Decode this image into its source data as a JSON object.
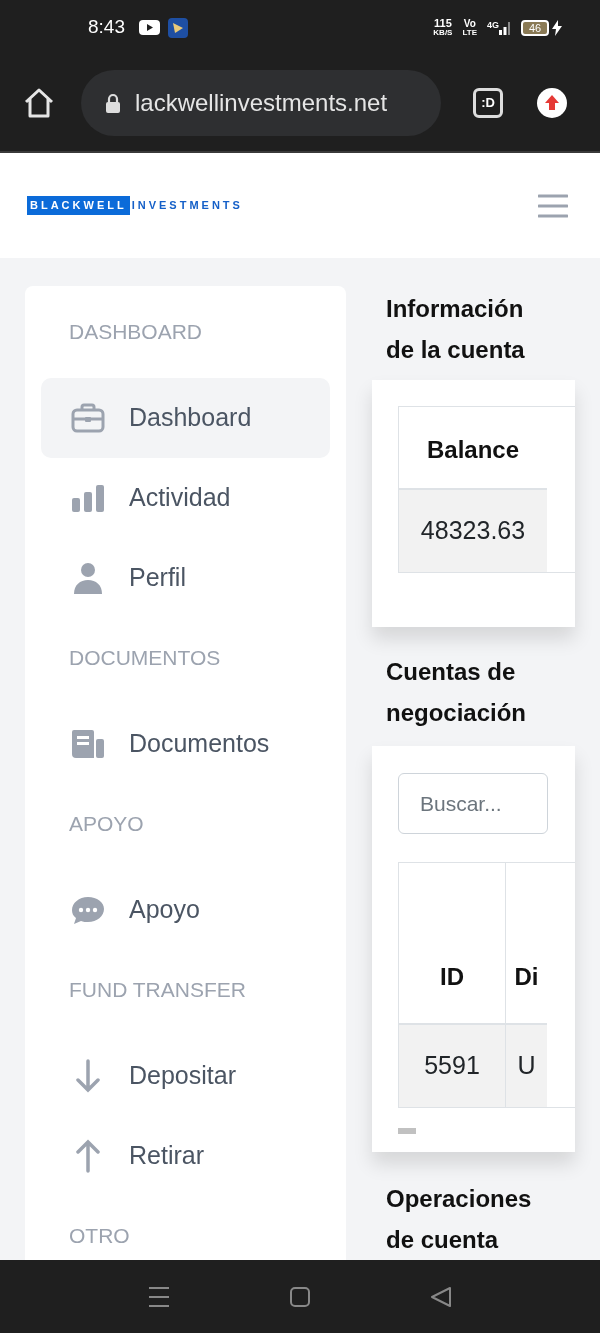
{
  "status_bar": {
    "time": "8:43",
    "speed": "115",
    "speed_unit": "KB/S",
    "volte": "Vo",
    "volte_sub": "LTE",
    "network": "4G",
    "battery": "46"
  },
  "browser": {
    "url": "lackwellinvestments.net",
    "tab_button": ":D"
  },
  "header": {
    "logo_boxed": "BLACKWELL",
    "logo_rest": "INVESTMENTS"
  },
  "sidebar": {
    "sections": [
      {
        "title": "DASHBOARD",
        "items": [
          {
            "label": "Dashboard",
            "kind": "briefcase",
            "selected": true
          },
          {
            "label": "Actividad",
            "kind": "chart",
            "selected": false
          },
          {
            "label": "Perfil",
            "kind": "user",
            "selected": false
          }
        ]
      },
      {
        "title": "DOCUMENTOS",
        "items": [
          {
            "label": "Documentos",
            "kind": "document",
            "selected": false
          }
        ]
      },
      {
        "title": "APOYO",
        "items": [
          {
            "label": "Apoyo",
            "kind": "chat",
            "selected": false
          }
        ]
      },
      {
        "title": "FUND TRANSFER",
        "items": [
          {
            "label": "Depositar",
            "kind": "down",
            "selected": false
          },
          {
            "label": "Retirar",
            "kind": "up",
            "selected": false
          }
        ]
      },
      {
        "title": "OTRO"
      }
    ]
  },
  "account_info": {
    "title": "Información de la cuenta",
    "table": {
      "columns": [
        "Balance"
      ],
      "rows": [
        [
          "48323.63"
        ]
      ]
    }
  },
  "trading_accounts": {
    "title": "Cuentas de negociación",
    "search": {
      "placeholder": "Buscar..."
    },
    "table": {
      "columns": [
        "ID",
        "Di"
      ],
      "rows": [
        [
          "5591",
          "U"
        ]
      ]
    }
  },
  "account_operations": {
    "title": "Operaciones de cuenta"
  }
}
